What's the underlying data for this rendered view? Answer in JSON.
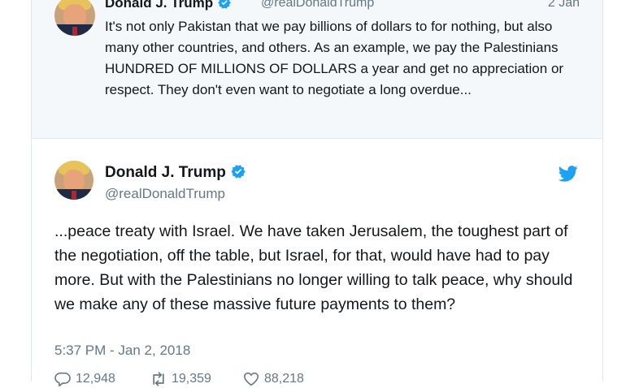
{
  "parent_tweet": {
    "name": "Donald J. Trump",
    "handle": "@realDonaldTrump",
    "date": "2 Jan",
    "text": "It's not only Pakistan that we pay billions of dollars to for nothing, but also many other countries, and others. As an example, we pay the Palestinians HUNDRED OF MILLIONS OF DOLLARS a year and get no appreciation or respect. They don't even want to negotiate a long overdue..."
  },
  "main_tweet": {
    "name": "Donald J. Trump",
    "handle": "@realDonaldTrump",
    "text": "...peace treaty with Israel. We have taken Jerusalem, the toughest part of the negotiation, off the table, but Israel, for that, would have had to pay more. But with the Palestinians no longer willing to talk peace, why should we make any of these massive future payments to them?",
    "timestamp": "5:37 PM - Jan 2, 2018",
    "replies": "12,948",
    "retweets": "19,359",
    "likes": "88,218"
  },
  "icons": {
    "verified": "verified-badge-icon",
    "twitter": "twitter-bird-icon",
    "reply": "reply-icon",
    "retweet": "retweet-icon",
    "like": "heart-icon"
  },
  "colors": {
    "accent": "#1da1f2",
    "text_primary": "#14171a",
    "text_secondary": "#657786",
    "parent_bg": "#f5f8fa"
  }
}
